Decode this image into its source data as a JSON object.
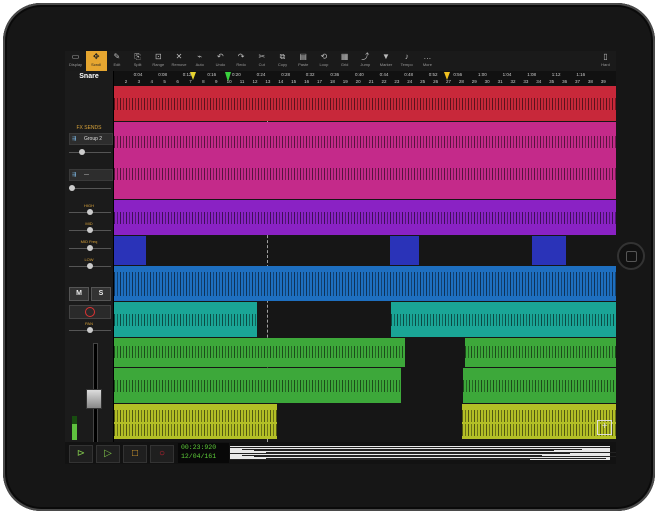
{
  "toolbar": {
    "items": [
      {
        "label": "Display",
        "glyph": "▭"
      },
      {
        "label": "Scroll",
        "glyph": "✥"
      },
      {
        "label": "Edit",
        "glyph": "✎"
      },
      {
        "label": "Split",
        "glyph": "⎘"
      },
      {
        "label": "Range",
        "glyph": "⊡"
      },
      {
        "label": "Remove",
        "glyph": "✕"
      },
      {
        "label": "Auto",
        "glyph": "⌁"
      },
      {
        "label": "Undo",
        "glyph": "↶"
      },
      {
        "label": "Redo",
        "glyph": "↷"
      },
      {
        "label": "Cut",
        "glyph": "✂"
      },
      {
        "label": "Copy",
        "glyph": "⧉"
      },
      {
        "label": "Paste",
        "glyph": "▤"
      },
      {
        "label": "Loop",
        "glyph": "⟲"
      },
      {
        "label": "Grid",
        "glyph": "▦"
      },
      {
        "label": "Jump",
        "glyph": "⤴"
      },
      {
        "label": "Marker",
        "glyph": "▼"
      },
      {
        "label": "Tempo",
        "glyph": "♪"
      },
      {
        "label": "More",
        "glyph": "…"
      }
    ],
    "right": {
      "label": "Hard",
      "glyph": "▯"
    },
    "active_index": 1
  },
  "left_panel": {
    "track_name": "Snare",
    "fx_sends_label": "FX SENDS",
    "send1": {
      "label": "Group 2",
      "icon": "⇶"
    },
    "send2": {
      "label": "—",
      "icon": "⇶"
    },
    "eq": {
      "high": "HIGH",
      "mid": "MID",
      "mid_freq": "MID Freq",
      "low": "LOW",
      "pan": "PAN"
    },
    "mute": "M",
    "solo": "S"
  },
  "ruler": {
    "times": [
      "0:04",
      "0:08",
      "0:12",
      "0:16",
      "0:20",
      "0:24",
      "0:28",
      "0:32",
      "0:36",
      "0:40",
      "0:44",
      "0:48",
      "0:52",
      "0:56",
      "1:00",
      "1:04",
      "1:08",
      "1:12",
      "1:16"
    ],
    "bars": [
      "2",
      "3",
      "4",
      "5",
      "6",
      "7",
      "8",
      "9",
      "10",
      "11",
      "12",
      "13",
      "14",
      "15",
      "16",
      "17",
      "18",
      "19",
      "20",
      "21",
      "22",
      "23",
      "24",
      "25",
      "26",
      "27",
      "28",
      "29",
      "30",
      "31",
      "32",
      "33",
      "34",
      "35",
      "36",
      "37",
      "38",
      "39"
    ]
  },
  "transport": {
    "time": "00:23:920",
    "position": "12/04/161"
  },
  "colors": {
    "red": "#c8283a",
    "magenta": "#c42a8a",
    "purple": "#8a22c4",
    "blue_dark": "#2a33b8",
    "blue": "#1e6fc0",
    "teal": "#1aa596",
    "green": "#3da83a",
    "olive": "#b3bf26",
    "accent": "#e6a630"
  }
}
